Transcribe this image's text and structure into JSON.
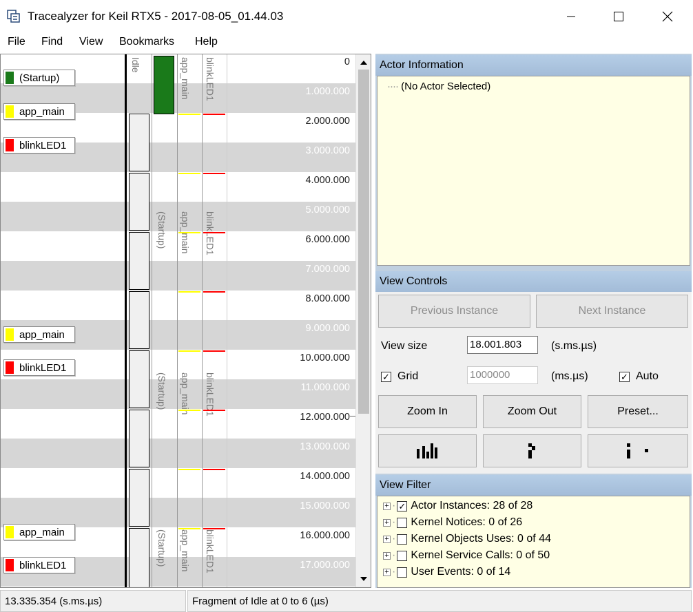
{
  "window": {
    "title": "Tracealyzer for Keil RTX5 - 2017-08-05_01.44.03"
  },
  "menu": [
    "File",
    "Find",
    "View",
    "Bookmarks",
    "Help"
  ],
  "trace": {
    "column_headers": {
      "idle": "Idle",
      "app_main": "app_main",
      "blinkled1": "blinkLED1"
    },
    "startup_label": "(Startup)",
    "actor_labels": [
      {
        "name": "(Startup)",
        "color": "#1a7a1a"
      },
      {
        "name": "app_main",
        "color": "#ffff00"
      },
      {
        "name": "blinkLED1",
        "color": "#ff0000"
      },
      {
        "name": "app_main",
        "color": "#ffff00"
      },
      {
        "name": "blinkLED1",
        "color": "#ff0000"
      },
      {
        "name": "app_main",
        "color": "#ffff00"
      },
      {
        "name": "blinkLED1",
        "color": "#ff0000"
      }
    ],
    "time_labels": [
      "0",
      "1.000.000",
      "2.000.000",
      "3.000.000",
      "4.000.000",
      "5.000.000",
      "6.000.000",
      "7.000.000",
      "8.000.000",
      "9.000.000",
      "10.000.000",
      "11.000.000",
      "12.000.000",
      "13.000.000",
      "14.000.000",
      "15.000.000",
      "16.000.000",
      "17.000.000"
    ]
  },
  "actor_info": {
    "title": "Actor Information",
    "text": "(No Actor Selected)"
  },
  "view_controls": {
    "title": "View Controls",
    "previous_instance": "Previous Instance",
    "next_instance": "Next Instance",
    "view_size_label": "View size",
    "view_size_value": "18.001.803",
    "view_size_unit": "(s.ms.µs)",
    "grid_label": "Grid",
    "grid_checked": true,
    "grid_value": "1000000",
    "grid_unit": "(ms.µs)",
    "auto_label": "Auto",
    "auto_checked": true,
    "zoom_in": "Zoom In",
    "zoom_out": "Zoom Out",
    "preset": "Preset..."
  },
  "view_filter": {
    "title": "View Filter",
    "items": [
      {
        "label": "Actor Instances: 28 of 28",
        "checked": true
      },
      {
        "label": "Kernel Notices: 0 of 26",
        "checked": false
      },
      {
        "label": "Kernel Objects Uses: 0 of 44",
        "checked": false
      },
      {
        "label": "Kernel Service Calls: 0 of 50",
        "checked": false
      },
      {
        "label": "User Events: 0 of 14",
        "checked": false
      }
    ]
  },
  "status": {
    "time": "13.335.354 (s.ms.µs)",
    "message": "Fragment of Idle at 0 to 6 (µs)"
  }
}
